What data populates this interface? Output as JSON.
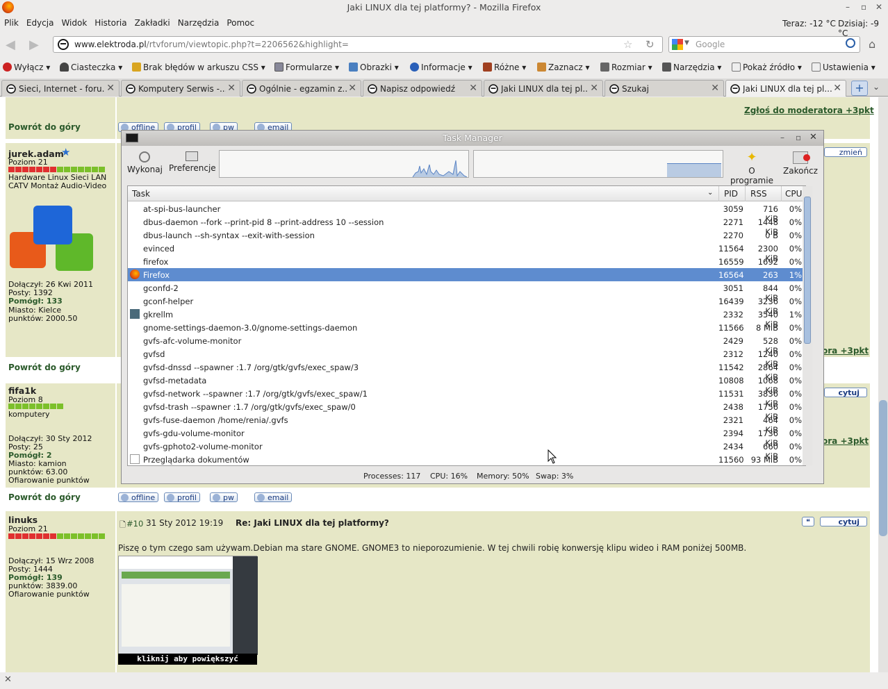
{
  "window": {
    "title": "Jaki LINUX dla tej platformy? - Mozilla Firefox"
  },
  "menu": {
    "items": [
      "Plik",
      "Edycja",
      "Widok",
      "Historia",
      "Zakładki",
      "Narzędzia",
      "Pomoc"
    ],
    "weather": [
      "Teraz: -12 °C",
      "Dzisiaj: -9 °C"
    ]
  },
  "nav": {
    "url_host": "www.elektroda.pl",
    "url_path": "/rtvforum/viewtopic.php?t=2206562&highlight=",
    "search_placeholder": "Google"
  },
  "toolbar": {
    "items": [
      "Wyłącz",
      "Ciasteczka",
      "Brak błędów w arkuszu CSS",
      "Formularze",
      "Obrazki",
      "Informacje",
      "Różne",
      "Zaznacz",
      "Rozmiar",
      "Narzędzia",
      "Pokaż źródło",
      "Ustawienia"
    ]
  },
  "tabs": [
    "Sieci, Internet - foru...",
    "Komputery Serwis -...",
    "Ogólnie - egzamin z...",
    "Napisz odpowiedź",
    "Jaki LINUX dla tej pl...",
    "Szukaj",
    "Jaki LINUX dla tej pl..."
  ],
  "forum": {
    "report_link": "Zgłoś do moderatora +3pkt",
    "back_to_top": "Powrót do góry",
    "change": "zmień",
    "quote": "cytuj",
    "buttons": {
      "offline": "offline",
      "profile": "profil",
      "pm": "pw",
      "email": "email"
    },
    "user1": {
      "name": "jurek.adam",
      "level": "Poziom 21",
      "tags": "Hardware Linux Sieci LAN CATV Montaż Audio-Video",
      "joined": "Dołączył: 26 Kwi 2011",
      "posts": "Posty: 1392",
      "helped": "Pomógł: 133",
      "city": "Miasto: Kielce",
      "points": "punktów: 2000.50"
    },
    "user2": {
      "name": "fifa1k",
      "level": "Poziom 8",
      "tags": "komputery",
      "joined": "Dołączył: 30 Sty 2012",
      "posts": "Posty: 25",
      "helped": "Pomógł: 2",
      "city": "Miasto: kamion",
      "points": "punktów: 63.00",
      "gift": "Ofiarowanie punktów"
    },
    "user3": {
      "name": "linuks",
      "level": "Poziom 21",
      "joined": "Dołączył: 15 Wrz 2008",
      "posts": "Posty: 1444",
      "helped": "Pomógł: 139",
      "points": "punktów: 3839.00",
      "gift": "Ofiarowanie punktów"
    },
    "post": {
      "number": "#10",
      "date": "31 Sty 2012 19:19",
      "title": "Re: Jaki LINUX dla tej platformy?",
      "body": "Piszę o tym czego sam używam.Debian ma stare GNOME. GNOME3 to nieporozumienie. W tej chwili robię konwersję klipu wideo i RAM poniżej 500MB.",
      "enlarge": "kliknij aby powiększyć",
      "partial_right": "ora +3pkt"
    }
  },
  "taskmanager": {
    "title": "Task Manager",
    "tools": {
      "run": "Wykonaj",
      "prefs": "Preferencje",
      "about": "O programie",
      "quit": "Zakończ"
    },
    "columns": {
      "task": "Task",
      "pid": "PID",
      "rss": "RSS",
      "cpu": "CPU"
    },
    "rows": [
      {
        "name": "at-spi-bus-launcher",
        "pid": "3059",
        "rss": "716 KiB",
        "cpu": "0%"
      },
      {
        "name": "dbus-daemon --fork --print-pid 8 --print-address 10 --session",
        "pid": "2271",
        "rss": "1448 KiB",
        "cpu": "0%"
      },
      {
        "name": "dbus-launch --sh-syntax --exit-with-session",
        "pid": "2270",
        "rss": "0 B",
        "cpu": "0%"
      },
      {
        "name": "evinced",
        "pid": "11564",
        "rss": "2300 KiB",
        "cpu": "0%"
      },
      {
        "name": "firefox",
        "pid": "16559",
        "rss": "1692 KiB",
        "cpu": "0%"
      },
      {
        "name": "Firefox",
        "pid": "16564",
        "rss": "263 MiB",
        "cpu": "1%"
      },
      {
        "name": "gconfd-2",
        "pid": "3051",
        "rss": "844 KiB",
        "cpu": "0%"
      },
      {
        "name": "gconf-helper",
        "pid": "16439",
        "rss": "3236 KiB",
        "cpu": "0%"
      },
      {
        "name": "gkrellm",
        "pid": "2332",
        "rss": "3540 KiB",
        "cpu": "1%"
      },
      {
        "name": "gnome-settings-daemon-3.0/gnome-settings-daemon",
        "pid": "11566",
        "rss": "8 MiB",
        "cpu": "0%"
      },
      {
        "name": "gvfs-afc-volume-monitor",
        "pid": "2429",
        "rss": "528 KiB",
        "cpu": "0%"
      },
      {
        "name": "gvfsd",
        "pid": "2312",
        "rss": "1240 KiB",
        "cpu": "0%"
      },
      {
        "name": "gvfsd-dnssd --spawner :1.7 /org/gtk/gvfs/exec_spaw/3",
        "pid": "11542",
        "rss": "2864 KiB",
        "cpu": "0%"
      },
      {
        "name": "gvfsd-metadata",
        "pid": "10808",
        "rss": "1068 KiB",
        "cpu": "0%"
      },
      {
        "name": "gvfsd-network --spawner :1.7 /org/gtk/gvfs/exec_spaw/1",
        "pid": "11531",
        "rss": "3836 KiB",
        "cpu": "0%"
      },
      {
        "name": "gvfsd-trash --spawner :1.7 /org/gtk/gvfs/exec_spaw/0",
        "pid": "2438",
        "rss": "1756 KiB",
        "cpu": "0%"
      },
      {
        "name": "gvfs-fuse-daemon /home/renia/.gvfs",
        "pid": "2321",
        "rss": "464 KiB",
        "cpu": "0%"
      },
      {
        "name": "gvfs-gdu-volume-monitor",
        "pid": "2394",
        "rss": "1736 KiB",
        "cpu": "0%"
      },
      {
        "name": "gvfs-gphoto2-volume-monitor",
        "pid": "2434",
        "rss": "660 KiB",
        "cpu": "0%"
      },
      {
        "name": "Przeglądarka dokumentów",
        "pid": "11560",
        "rss": "93 MiB",
        "cpu": "0%"
      }
    ],
    "selected_row": "Firefox",
    "status": {
      "processes": "Processes: 117",
      "cpu": "CPU: 16%",
      "memory": "Memory: 50%",
      "swap": "Swap: 3%"
    }
  },
  "colors": {
    "selection": "#5e8ccf",
    "forum_bg": "#e6e7c6",
    "forum_link": "#2b5a2b"
  }
}
